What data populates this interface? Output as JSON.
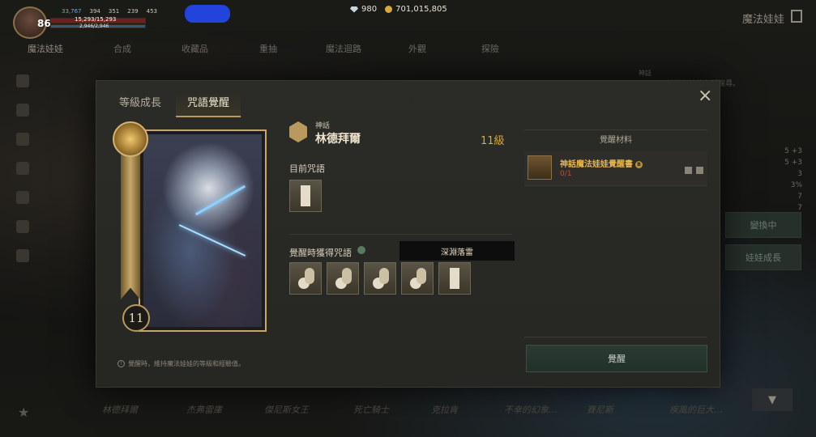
{
  "player": {
    "level": "86",
    "stats": [
      "33,767",
      "394",
      "351",
      "239",
      "453"
    ],
    "hp": "15,293/15,293",
    "mp": "2,946/2,946"
  },
  "currency": {
    "gems": "980",
    "gold": "701,015,805"
  },
  "app_title": "魔法娃娃",
  "nav_tabs": [
    "魔法娃娃",
    "合成",
    "收藏品",
    "重抽",
    "魔法迴路",
    "外觀",
    "探險"
  ],
  "search": {
    "placeholder": "請輸入娃娃名稱搜尋。"
  },
  "bg_rarity_label": "神話",
  "right_stats": [
    "5 +3",
    "5 +3",
    "3",
    "3%",
    "7",
    "7"
  ],
  "right_buttons": {
    "equipped": "變換中",
    "growth": "娃娃成長"
  },
  "bottom_names": [
    "林德拜爾",
    "杰弗雷庫",
    "傑尼斯女王",
    "死亡騎士",
    "克拉肯",
    "不幸的幻象…",
    "賽尼斯",
    "疾風的巨大…"
  ],
  "modal": {
    "tabs": [
      "等級成長",
      "咒語覺醒"
    ],
    "active_tab": 1,
    "doll": {
      "rarity": "神話",
      "name": "林德拜爾",
      "level": "11級",
      "card_level": "11"
    },
    "current_spell_label": "目前咒語",
    "awaken_spells_label": "覺醒時獲得咒語",
    "tooltip": "深淵落雷",
    "note": "覺醒時，維持魔法娃娃的等級和經驗值。",
    "materials": {
      "title": "覺醒材料",
      "items": [
        {
          "name": "神話魔法娃娃覺醒書",
          "count": "0/1"
        }
      ]
    },
    "awaken_button": "覺醒"
  },
  "colors": {
    "accent_gold": "#b89a5e",
    "level_orange": "#d8a93a",
    "count_red": "#c24a3a",
    "material_gold": "#e8b54a"
  }
}
